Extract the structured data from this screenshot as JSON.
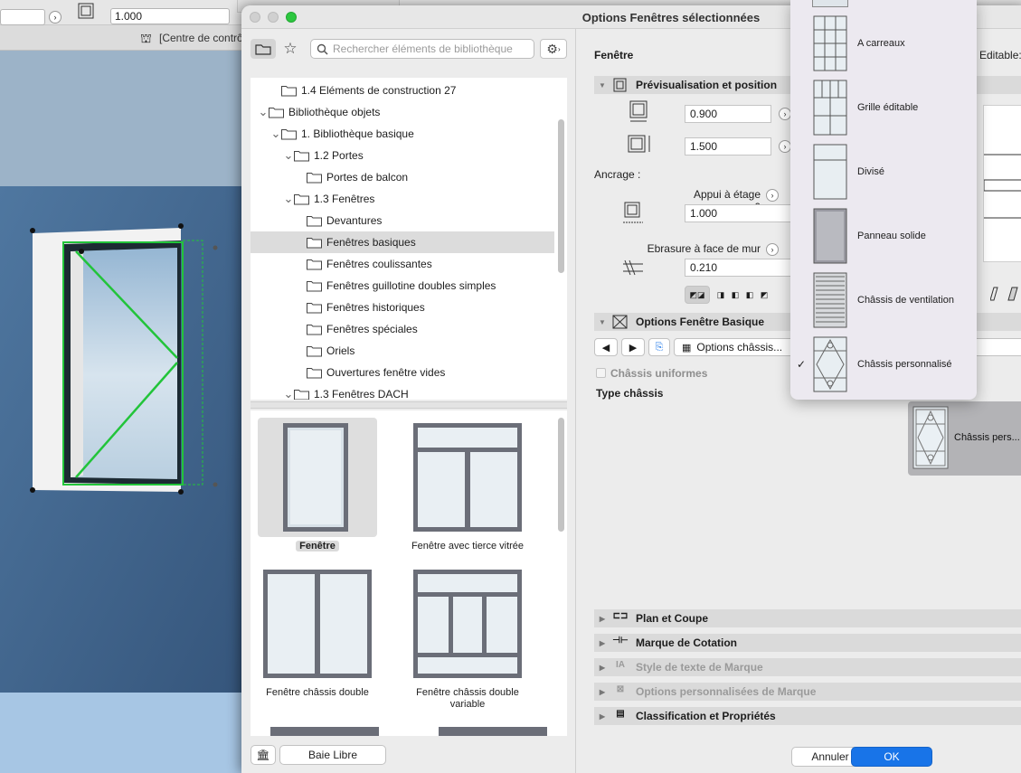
{
  "background_app": {
    "toolbar_field_value": "1.000",
    "toolbar_label_top": "Appui à étage 0",
    "toolbar_label_ebrasure": "Ebrasure face de mur",
    "control_label": "[Centre de contrô"
  },
  "dialog": {
    "title": "Options Fenêtres sélectionnées"
  },
  "library": {
    "search_placeholder": "Rechercher éléments de bibliothèque",
    "tree": [
      {
        "label": "1.4 Eléments de construction 27",
        "level": 1,
        "expanded": null
      },
      {
        "label": "Bibliothèque objets",
        "level": 0,
        "expanded": true
      },
      {
        "label": "1. Bibliothèque basique",
        "level": 1,
        "expanded": true
      },
      {
        "label": "1.2 Portes",
        "level": 2,
        "expanded": true
      },
      {
        "label": "Portes de balcon",
        "level": 3,
        "expanded": null
      },
      {
        "label": "1.3 Fenêtres",
        "level": 2,
        "expanded": true
      },
      {
        "label": "Devantures",
        "level": 3,
        "expanded": null
      },
      {
        "label": "Fenêtres basiques",
        "level": 3,
        "expanded": null,
        "selected": true
      },
      {
        "label": "Fenêtres coulissantes",
        "level": 3,
        "expanded": null
      },
      {
        "label": "Fenêtres guillotine doubles simples",
        "level": 3,
        "expanded": null
      },
      {
        "label": "Fenêtres historiques",
        "level": 3,
        "expanded": null
      },
      {
        "label": "Fenêtres spéciales",
        "level": 3,
        "expanded": null
      },
      {
        "label": "Oriels",
        "level": 3,
        "expanded": null
      },
      {
        "label": "Ouvertures fenêtre vides",
        "level": 3,
        "expanded": null
      },
      {
        "label": "1.3 Fenêtres DACH",
        "level": 2,
        "expanded": true
      }
    ],
    "gallery": [
      {
        "label": "Fenêtre",
        "selected": true,
        "style": "single"
      },
      {
        "label": "Fenêtre avec tierce vitrée",
        "selected": false,
        "style": "transom"
      },
      {
        "label": "Fenêtre châssis double",
        "selected": false,
        "style": "double"
      },
      {
        "label": "Fenêtre châssis double variable",
        "selected": false,
        "style": "double-variable"
      }
    ],
    "bottom_button": "Baie Libre"
  },
  "settings": {
    "element_name": "Fenêtre",
    "editable_label": "Editable:",
    "preview_section": "Prévisualisation et position",
    "width_value": "0.900",
    "height_value": "1.500",
    "anchor_label": "Ancrage :",
    "sill_label": "Appui à étage 0",
    "sill_value": "1.000",
    "reveal_label": "Ebrasure à face de mur",
    "reveal_value": "0.210",
    "options_section": "Options Fenêtre Basique",
    "options_dropdown": "Options châssis...",
    "uniform_sash_label": "Châssis uniformes",
    "sash_type_label": "Type châssis",
    "sash_tile_label": "Châssis pers...",
    "collapsed_sections": [
      {
        "label": "Plan et Coupe",
        "disabled": false
      },
      {
        "label": "Marque de Cotation",
        "disabled": false
      },
      {
        "label": "Style de texte de Marque",
        "disabled": true
      },
      {
        "label": "Options personnalisées de Marque",
        "disabled": true
      },
      {
        "label": "Classification et Propriétés",
        "disabled": false
      }
    ],
    "cancel_button": "Annuler",
    "ok_button": "OK"
  },
  "sash_menu": {
    "items": [
      {
        "label": "A carreaux",
        "style": "grid",
        "checked": false
      },
      {
        "label": "Grille éditable",
        "style": "editable-grid",
        "checked": false
      },
      {
        "label": "Divisé",
        "style": "divided",
        "checked": false
      },
      {
        "label": "Panneau solide",
        "style": "solid",
        "checked": false
      },
      {
        "label": "Châssis de ventilation",
        "style": "louver",
        "checked": false
      },
      {
        "label": "Châssis personnalisé",
        "style": "custom",
        "checked": true
      }
    ],
    "check_glyph": "✓"
  },
  "colors": {
    "accent": "#1874e8",
    "wall": "#3d5f86",
    "selection_green": "#22c43a"
  }
}
